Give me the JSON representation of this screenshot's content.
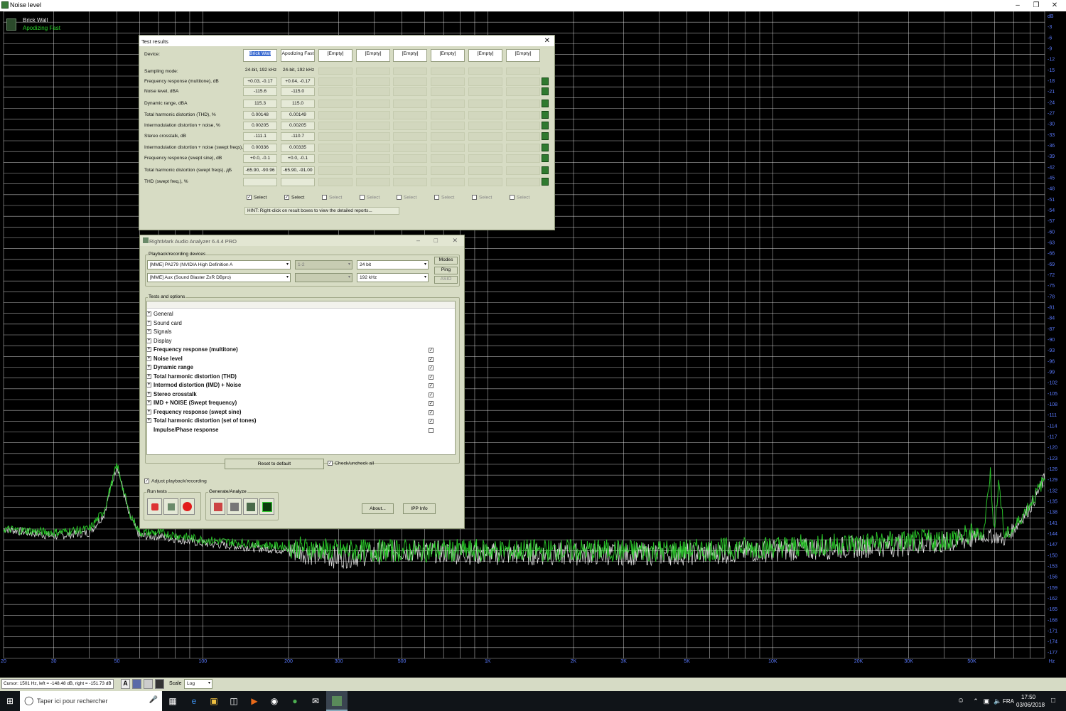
{
  "window": {
    "title": "Noise level"
  },
  "legend": {
    "series1": "Brick Wall",
    "series2": "Apodizing Fast"
  },
  "colors": {
    "grid": "#e8e8e8",
    "series1": "#ffffff",
    "series2": "#2bd42b",
    "panel": "#d7dcc4"
  },
  "chart_data": {
    "type": "line",
    "xscale": "log",
    "xlim": [
      20,
      90000
    ],
    "ylim": [
      -180,
      0
    ],
    "x_tick_labels": [
      "20",
      "30",
      "50",
      "100",
      "200",
      "300",
      "500",
      "1K",
      "2K",
      "3K",
      "5K",
      "10K",
      "20K",
      "30K",
      "50K",
      "Hz"
    ],
    "y_tick_labels": [
      "dB",
      "-3",
      "-6",
      "-9",
      "-12",
      "-15",
      "-18",
      "-21",
      "-24",
      "-27",
      "-30",
      "-33",
      "-36",
      "-39",
      "-42",
      "-45",
      "-48",
      "-51",
      "-54",
      "-57",
      "-60",
      "-63",
      "-66",
      "-69",
      "-72",
      "-75",
      "-78",
      "-81",
      "-84",
      "-87",
      "-90",
      "-93",
      "-96",
      "-99",
      "-102",
      "-105",
      "-108",
      "-111",
      "-114",
      "-117",
      "-120",
      "-123",
      "-126",
      "-129",
      "-132",
      "-135",
      "-138",
      "-141",
      "-144",
      "-147",
      "-150",
      "-153",
      "-156",
      "-159",
      "-162",
      "-165",
      "-168",
      "-171",
      "-174",
      "-177"
    ],
    "series": [
      {
        "name": "Brick Wall",
        "x": [
          20,
          30,
          40,
          45,
          50,
          55,
          60,
          70,
          100,
          200,
          300,
          500,
          1000,
          2000,
          5000,
          10000,
          20000,
          40000,
          55000,
          60000,
          65000,
          70000,
          80000,
          90000
        ],
        "y": [
          -144,
          -146,
          -145,
          -140,
          -126,
          -140,
          -146,
          -146,
          -148,
          -150,
          -152,
          -150,
          -151,
          -151,
          -151,
          -150,
          -149,
          -148,
          -146,
          -146,
          -147,
          -144,
          -138,
          -130
        ]
      },
      {
        "name": "Apodizing Fast",
        "x": [
          20,
          30,
          40,
          45,
          50,
          55,
          60,
          70,
          100,
          200,
          300,
          500,
          1000,
          2000,
          5000,
          10000,
          20000,
          40000,
          55000,
          58000,
          60000,
          62000,
          65000,
          70000,
          80000,
          90000
        ],
        "y": [
          -144,
          -145,
          -144,
          -139,
          -126,
          -139,
          -145,
          -145,
          -147,
          -149,
          -150,
          -150,
          -150,
          -150,
          -150,
          -149,
          -148,
          -147,
          -145,
          -128,
          -146,
          -130,
          -146,
          -144,
          -137,
          -130
        ]
      }
    ]
  },
  "test_results": {
    "title": "Test results",
    "device_label": "Device:",
    "columns": [
      "Brick Wall",
      "Apodizing Fast",
      "[Empty]",
      "[Empty]",
      "[Empty]",
      "[Empty]",
      "[Empty]",
      "[Empty]"
    ],
    "rows": [
      {
        "label": "Sampling mode:",
        "v1": "24-bit, 192 kHz",
        "v2": "24-bit, 192 kHz"
      },
      {
        "label": "Frequency response (multitone), dB",
        "v1": "+0.03, -0.17",
        "v2": "+0.04, -0.17"
      },
      {
        "label": "Noise level, dBA",
        "v1": "-115.6",
        "v2": "-115.0"
      },
      {
        "label": "Dynamic range, dBA",
        "v1": "115.3",
        "v2": "115.0"
      },
      {
        "label": "Total harmonic distortion (THD), %",
        "v1": "0.00148",
        "v2": "0.00149"
      },
      {
        "label": "Intermodulation distortion + noise, %",
        "v1": "0.00205",
        "v2": "0.00205"
      },
      {
        "label": "Stereo crosstalk, dB",
        "v1": "-111.1",
        "v2": "-110.7"
      },
      {
        "label": "Intermodulation distortion + noise (swept freqs), %",
        "v1": "0.00336",
        "v2": "0.00335"
      },
      {
        "label": "Frequency response (swept sine), dB",
        "v1": "+0.0, -0.1",
        "v2": "+0.0, -0.1"
      },
      {
        "label": "Total harmonic distortion (swept freqs), дБ",
        "v1": "-65.90, -90.96",
        "v2": "-65.90, -91.00"
      },
      {
        "label": "THD (swept freq.), %",
        "v1": "",
        "v2": ""
      }
    ],
    "select_label": "Select",
    "hint": "HINT: Right-click on result boxes to view the detailed reports..."
  },
  "analyzer": {
    "title": "RightMark Audio Analyzer 6.4.4 PRO",
    "devices_group": "Playback/recording devices",
    "playback_device": "[MME] PA279 (NVIDIA High Definition A",
    "recording_device": "[MME] Aux (Sound Blaster ZxR DBpro)",
    "channels": "1-2",
    "bits": "24 bit",
    "rate": "192 kHz",
    "modes_btn": "Modes",
    "ping_btn": "Ping",
    "asio_btn": "ASIO",
    "tests_group": "Tests and options",
    "tree": [
      {
        "label": "General",
        "bold": false,
        "checked": null
      },
      {
        "label": "Sound card",
        "bold": false,
        "checked": null
      },
      {
        "label": "Signals",
        "bold": false,
        "checked": null
      },
      {
        "label": "Display",
        "bold": false,
        "checked": null
      },
      {
        "label": "Frequency response (multitone)",
        "bold": true,
        "checked": true
      },
      {
        "label": "Noise level",
        "bold": true,
        "checked": true
      },
      {
        "label": "Dynamic range",
        "bold": true,
        "checked": true
      },
      {
        "label": "Total harmonic distortion (THD)",
        "bold": true,
        "checked": true
      },
      {
        "label": "Intermod distortion (IMD) + Noise",
        "bold": true,
        "checked": true
      },
      {
        "label": "Stereo crosstalk",
        "bold": true,
        "checked": true
      },
      {
        "label": "IMD + NOISE (Swept frequency)",
        "bold": true,
        "checked": true
      },
      {
        "label": "Frequency response (swept sine)",
        "bold": true,
        "checked": true
      },
      {
        "label": "Total harmonic distortion (set of tones)",
        "bold": true,
        "checked": true
      },
      {
        "label": "Impulse/Phase response",
        "bold": true,
        "checked": false
      }
    ],
    "reset_btn": "Reset to default",
    "check_all": "Check/uncheck all",
    "adjust": "Adjust playback/recording",
    "run_tests": "Run tests",
    "generate": "Generate/Analyze",
    "about_btn": "About...",
    "ipp_btn": "IPP Info"
  },
  "status": {
    "cursor": "Cursor:  1501 Hz,  left = -148.48 dB,  right = -151.73 dB",
    "scale_label": "Scale",
    "scale_value": "Log"
  },
  "taskbar": {
    "search": "Taper ici pour rechercher",
    "lang": "FRA",
    "time": "17:50",
    "date": "03/06/2018"
  }
}
